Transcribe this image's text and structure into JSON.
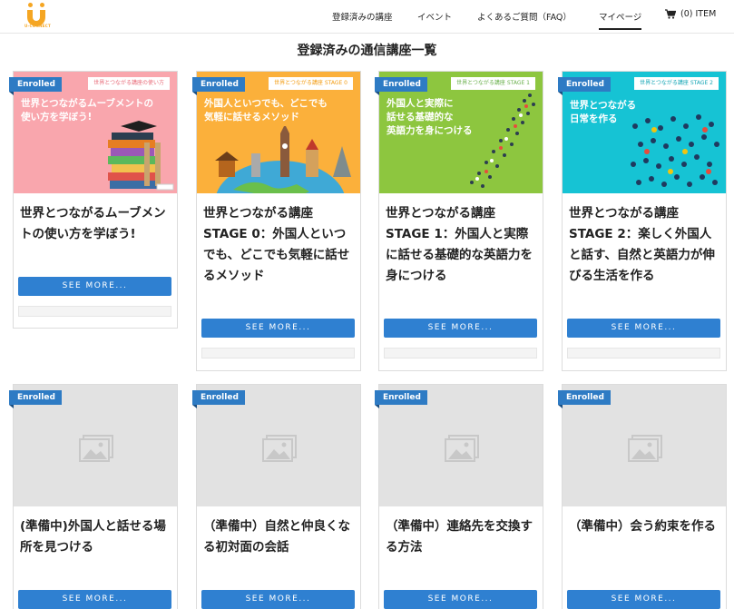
{
  "header": {
    "logo_text": "U-CONNECT",
    "nav": [
      {
        "label": "登録済みの講座"
      },
      {
        "label": "イベント"
      },
      {
        "label": "よくあるご質問（FAQ）"
      },
      {
        "label": "マイページ"
      }
    ],
    "cart_label": "(0) ITEM"
  },
  "page_title": "登録済みの通信講座一覧",
  "badge_label": "Enrolled",
  "see_more_label": "SEE MORE...",
  "courses": [
    {
      "title": "世界とつながるムーブメントの使い方を学ぼう!",
      "banner_tag": "世界とつながる講座の使い方",
      "banner_text_1": "世界とつながるムーブメントの",
      "banner_text_2": "使い方を学ぼう!",
      "banner_color": "#f9a6ad"
    },
    {
      "title": "世界とつながる講座 STAGE 0：外国人といつでも、どこでも気軽に話せるメソッド",
      "banner_tag": "世界とつながる講座 STAGE 0",
      "banner_text_1": "外国人といつでも、どこでも",
      "banner_text_2": "気軽に話せるメソッド",
      "banner_color": "#fbb03b"
    },
    {
      "title": "世界とつながる講座 STAGE 1：外国人と実際に話せる基礎的な英語力を身につける",
      "banner_tag": "世界とつながる講座 STAGE 1",
      "banner_text_1": "外国人と実際に",
      "banner_text_2": "話せる基礎的な",
      "banner_text_3": "英語力を身につける",
      "banner_color": "#8dc63f"
    },
    {
      "title": "世界とつながる講座 STAGE 2：楽しく外国人と話す、自然と英語力が伸びる生活を作る",
      "banner_tag": "世界とつながる講座 STAGE 2",
      "banner_text_1": "世界とつながる",
      "banner_text_2": "日常を作る",
      "banner_color": "#16c3d4"
    },
    {
      "title": "(準備中)外国人と話せる場所を見つける"
    },
    {
      "title": "（準備中）自然と仲良くなる初対面の会話"
    },
    {
      "title": "（準備中）連絡先を交換する方法"
    },
    {
      "title": "（準備中）会う約束を作る"
    }
  ]
}
